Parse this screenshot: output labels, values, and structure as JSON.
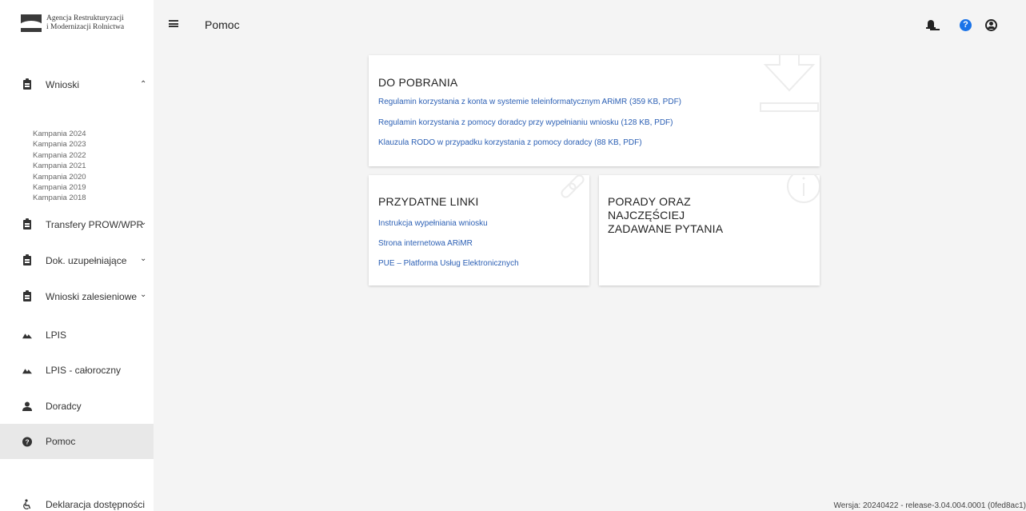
{
  "app": {
    "logo_line1": "Agencja Restrukturyzacji",
    "logo_line2": "i Modernizacji Rolnictwa",
    "page_title": "Pomoc",
    "version": "Wersja: 20240422 - release-3.04.004.0001 (0fed8ac1)"
  },
  "sidebar": {
    "wnioski": {
      "label": "Wnioski",
      "campaigns": [
        "Kampania 2024",
        "Kampania 2023",
        "Kampania 2022",
        "Kampania 2021",
        "Kampania 2020",
        "Kampania 2019",
        "Kampania 2018"
      ]
    },
    "transfery": "Transfery PROW/WPR",
    "dok": "Dok. uzupełniające",
    "zalesieniowe": "Wnioski zalesieniowe",
    "lpis": "LPIS",
    "lpis_caloroczny": "LPIS - całoroczny",
    "doradcy": "Doradcy",
    "pomoc": "Pomoc",
    "deklaracja": "Deklaracja dostępności"
  },
  "downloads": {
    "title": "DO POBRANIA",
    "links": [
      "Regulamin korzystania z konta w systemie teleinformatycznym ARiMR (359 KB, PDF)",
      "Regulamin korzystania z pomocy doradcy przy wypełnianiu wniosku (128 KB, PDF)",
      "Klauzula RODO w przypadku korzystania z pomocy doradcy (88 KB, PDF)"
    ]
  },
  "useful_links": {
    "title": "PRZYDATNE LINKI",
    "links": [
      "Instrukcja wypełniania wniosku",
      "Strona internetowa ARiMR",
      "PUE – Platforma Usług Elektronicznych"
    ]
  },
  "faq": {
    "title_line1": "PORADY ORAZ",
    "title_line2": "NAJCZĘŚCIEJ",
    "title_line3": "ZADAWANE PYTANIA"
  },
  "icons": {
    "menu": "menu-icon",
    "bell": "bell-icon",
    "help": "help-icon",
    "user": "user-icon",
    "accent": "#1a73e8",
    "link_color": "#2b5fb4"
  }
}
